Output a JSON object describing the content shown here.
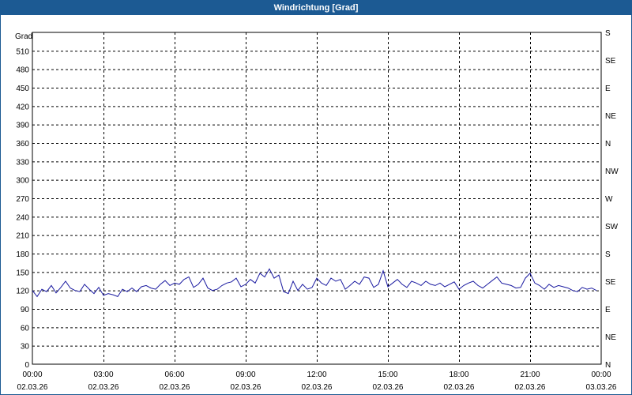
{
  "window": {
    "title": "Windrichtung [Grad]"
  },
  "colors": {
    "titlebar": "#1c5a93",
    "series": "#1a1aa0",
    "grid": "#000000"
  },
  "chart_data": {
    "type": "line",
    "title": "Windrichtung [Grad]",
    "ylabel": "Grad",
    "ylim": [
      0,
      540
    ],
    "yticks": [
      0,
      30,
      60,
      90,
      120,
      150,
      180,
      210,
      240,
      270,
      300,
      330,
      360,
      390,
      420,
      450,
      480,
      510
    ],
    "y_right_ticks": [
      {
        "value": 0,
        "label": "N"
      },
      {
        "value": 45,
        "label": "NE"
      },
      {
        "value": 90,
        "label": "E"
      },
      {
        "value": 135,
        "label": "SE"
      },
      {
        "value": 180,
        "label": "S"
      },
      {
        "value": 225,
        "label": "SW"
      },
      {
        "value": 270,
        "label": "W"
      },
      {
        "value": 315,
        "label": "NW"
      },
      {
        "value": 360,
        "label": "N"
      },
      {
        "value": 405,
        "label": "NE"
      },
      {
        "value": 450,
        "label": "E"
      },
      {
        "value": 495,
        "label": "SE"
      },
      {
        "value": 540,
        "label": "S"
      }
    ],
    "xlim_hours": [
      0,
      24
    ],
    "xticks": [
      {
        "hour": 0,
        "time": "00:00",
        "date": "02.03.26"
      },
      {
        "hour": 3,
        "time": "03:00",
        "date": "02.03.26"
      },
      {
        "hour": 6,
        "time": "06:00",
        "date": "02.03.26"
      },
      {
        "hour": 9,
        "time": "09:00",
        "date": "02.03.26"
      },
      {
        "hour": 12,
        "time": "12:00",
        "date": "02.03.26"
      },
      {
        "hour": 15,
        "time": "15:00",
        "date": "02.03.26"
      },
      {
        "hour": 18,
        "time": "18:00",
        "date": "02.03.26"
      },
      {
        "hour": 21,
        "time": "21:00",
        "date": "02.03.26"
      },
      {
        "hour": 24,
        "time": "00:00",
        "date": "03.03.26"
      }
    ],
    "grid": true,
    "series": [
      {
        "x_hours": [
          0.0,
          0.2,
          0.4,
          0.6,
          0.8,
          1.0,
          1.2,
          1.4,
          1.6,
          1.8,
          2.0,
          2.2,
          2.4,
          2.6,
          2.8,
          3.0,
          3.2,
          3.4,
          3.6,
          3.8,
          4.0,
          4.2,
          4.4,
          4.6,
          4.8,
          5.0,
          5.2,
          5.4,
          5.6,
          5.8,
          6.0,
          6.2,
          6.4,
          6.6,
          6.8,
          7.0,
          7.2,
          7.4,
          7.6,
          7.8,
          8.0,
          8.2,
          8.4,
          8.6,
          8.8,
          9.0,
          9.2,
          9.4,
          9.6,
          9.8,
          10.0,
          10.2,
          10.4,
          10.6,
          10.8,
          11.0,
          11.2,
          11.4,
          11.6,
          11.8,
          12.0,
          12.2,
          12.4,
          12.6,
          12.8,
          13.0,
          13.2,
          13.4,
          13.6,
          13.8,
          14.0,
          14.2,
          14.4,
          14.6,
          14.8,
          15.0,
          15.2,
          15.4,
          15.6,
          15.8,
          16.0,
          16.2,
          16.4,
          16.6,
          16.8,
          17.0,
          17.2,
          17.4,
          17.6,
          17.8,
          18.0,
          18.2,
          18.4,
          18.6,
          18.8,
          19.0,
          19.2,
          19.4,
          19.6,
          19.8,
          20.0,
          20.2,
          20.4,
          20.6,
          20.8,
          21.0,
          21.2,
          21.4,
          21.6,
          21.8,
          22.0,
          22.2,
          22.4,
          22.6,
          22.8,
          23.0,
          23.2,
          23.4,
          23.6,
          23.8,
          24.0
        ],
        "values": [
          120,
          110,
          122,
          118,
          128,
          116,
          125,
          135,
          124,
          120,
          118,
          130,
          122,
          115,
          125,
          112,
          115,
          113,
          110,
          122,
          118,
          124,
          118,
          126,
          128,
          124,
          122,
          130,
          136,
          128,
          132,
          130,
          138,
          142,
          125,
          130,
          140,
          124,
          120,
          122,
          128,
          132,
          134,
          140,
          126,
          130,
          138,
          132,
          148,
          142,
          155,
          140,
          145,
          118,
          115,
          135,
          120,
          130,
          122,
          125,
          140,
          132,
          128,
          140,
          135,
          138,
          122,
          128,
          135,
          130,
          142,
          140,
          125,
          130,
          152,
          126,
          132,
          138,
          130,
          125,
          135,
          132,
          128,
          135,
          130,
          128,
          132,
          126,
          130,
          134,
          122,
          128,
          132,
          135,
          128,
          124,
          130,
          136,
          142,
          132,
          130,
          128,
          124,
          125,
          140,
          148,
          132,
          128,
          122,
          130,
          125,
          128,
          126,
          124,
          120,
          118,
          125,
          122,
          124,
          120
        ]
      }
    ]
  }
}
